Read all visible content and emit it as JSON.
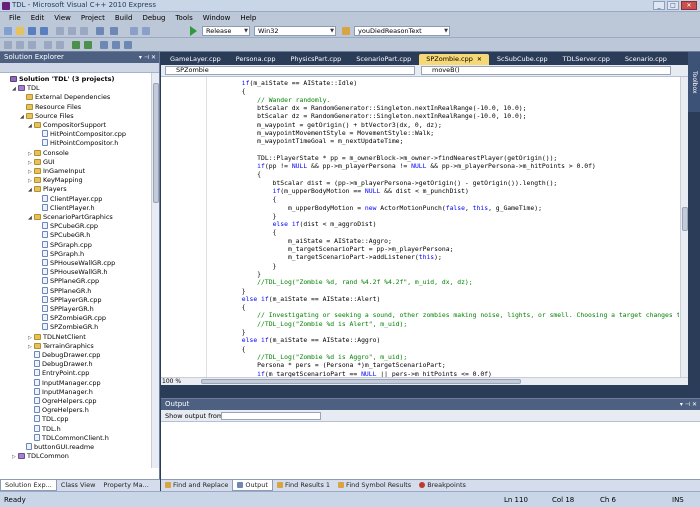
{
  "window": {
    "title": "TDL - Microsoft Visual C++ 2010 Express"
  },
  "menu": [
    "File",
    "Edit",
    "View",
    "Project",
    "Build",
    "Debug",
    "Tools",
    "Window",
    "Help"
  ],
  "toolbar": {
    "config": "Release",
    "platform": "Win32",
    "find_text": "youDiedReasonText"
  },
  "solution_explorer": {
    "title": "Solution Explorer",
    "tree": [
      {
        "label": "Solution 'TDL' (3 projects)",
        "indent": 0,
        "type": "sln",
        "expander": "",
        "bold": true
      },
      {
        "label": "TDL",
        "indent": 1,
        "type": "proj",
        "expander": "◢"
      },
      {
        "label": "External Dependencies",
        "indent": 2,
        "type": "folder",
        "expander": ""
      },
      {
        "label": "Resource Files",
        "indent": 2,
        "type": "folder",
        "expander": ""
      },
      {
        "label": "Source Files",
        "indent": 2,
        "type": "folder",
        "expander": "◢"
      },
      {
        "label": "CompositorSupport",
        "indent": 3,
        "type": "folder",
        "expander": "◢"
      },
      {
        "label": "HitPointCompositor.cpp",
        "indent": 4,
        "type": "file",
        "expander": ""
      },
      {
        "label": "HitPointCompositor.h",
        "indent": 4,
        "type": "file",
        "expander": ""
      },
      {
        "label": "Console",
        "indent": 3,
        "type": "folder",
        "expander": "▷"
      },
      {
        "label": "GUI",
        "indent": 3,
        "type": "folder",
        "expander": "▷"
      },
      {
        "label": "InGameInput",
        "indent": 3,
        "type": "folder",
        "expander": "▷"
      },
      {
        "label": "KeyMapping",
        "indent": 3,
        "type": "folder",
        "expander": "▷"
      },
      {
        "label": "Players",
        "indent": 3,
        "type": "folder",
        "expander": "◢"
      },
      {
        "label": "ClientPlayer.cpp",
        "indent": 4,
        "type": "file",
        "expander": ""
      },
      {
        "label": "ClientPlayer.h",
        "indent": 4,
        "type": "file",
        "expander": ""
      },
      {
        "label": "ScenarioPartGraphics",
        "indent": 3,
        "type": "folder",
        "expander": "◢"
      },
      {
        "label": "SPCubeGR.cpp",
        "indent": 4,
        "type": "file",
        "expander": ""
      },
      {
        "label": "SPCubeGR.h",
        "indent": 4,
        "type": "file",
        "expander": ""
      },
      {
        "label": "SPGraph.cpp",
        "indent": 4,
        "type": "file",
        "expander": ""
      },
      {
        "label": "SPGraph.h",
        "indent": 4,
        "type": "file",
        "expander": ""
      },
      {
        "label": "SPHouseWallGR.cpp",
        "indent": 4,
        "type": "file",
        "expander": ""
      },
      {
        "label": "SPHouseWallGR.h",
        "indent": 4,
        "type": "file",
        "expander": ""
      },
      {
        "label": "SPPlaneGR.cpp",
        "indent": 4,
        "type": "file",
        "expander": ""
      },
      {
        "label": "SPPlaneGR.h",
        "indent": 4,
        "type": "file",
        "expander": ""
      },
      {
        "label": "SPPlayerGR.cpp",
        "indent": 4,
        "type": "file",
        "expander": ""
      },
      {
        "label": "SPPlayerGR.h",
        "indent": 4,
        "type": "file",
        "expander": ""
      },
      {
        "label": "SPZombieGR.cpp",
        "indent": 4,
        "type": "file",
        "expander": ""
      },
      {
        "label": "SPZombieGR.h",
        "indent": 4,
        "type": "file",
        "expander": ""
      },
      {
        "label": "TDLNetClient",
        "indent": 3,
        "type": "folder",
        "expander": "▷"
      },
      {
        "label": "TerrainGraphics",
        "indent": 3,
        "type": "folder",
        "expander": "▷"
      },
      {
        "label": "DebugDrawer.cpp",
        "indent": 3,
        "type": "file",
        "expander": ""
      },
      {
        "label": "DebugDrawer.h",
        "indent": 3,
        "type": "file",
        "expander": ""
      },
      {
        "label": "EntryPoint.cpp",
        "indent": 3,
        "type": "file",
        "expander": ""
      },
      {
        "label": "InputManager.cpp",
        "indent": 3,
        "type": "file",
        "expander": ""
      },
      {
        "label": "InputManager.h",
        "indent": 3,
        "type": "file",
        "expander": ""
      },
      {
        "label": "OgreHelpers.cpp",
        "indent": 3,
        "type": "file",
        "expander": ""
      },
      {
        "label": "OgreHelpers.h",
        "indent": 3,
        "type": "file",
        "expander": ""
      },
      {
        "label": "TDL.cpp",
        "indent": 3,
        "type": "file",
        "expander": ""
      },
      {
        "label": "TDL.h",
        "indent": 3,
        "type": "file",
        "expander": ""
      },
      {
        "label": "TDLCommonClient.h",
        "indent": 3,
        "type": "file",
        "expander": ""
      },
      {
        "label": "buttonGUI.readme",
        "indent": 2,
        "type": "file",
        "expander": ""
      },
      {
        "label": "TDLCommon",
        "indent": 1,
        "type": "proj",
        "expander": "▷"
      }
    ],
    "bottom_tabs": [
      "Solution Exp...",
      "Class View",
      "Property Ma..."
    ]
  },
  "doc_tabs": [
    "GameLayer.cpp",
    "Persona.cpp",
    "PhysicsPart.cpp",
    "ScenarioPart.cpp",
    "SPZombie.cpp",
    "ScSubCube.cpp",
    "TDLServer.cpp",
    "Scenario.cpp"
  ],
  "active_tab_index": 4,
  "toolbox_label": "Toolbox",
  "nav": {
    "class": "SPZombie",
    "member": "moveB()"
  },
  "zoom": "100 %",
  "code": [
    {
      "t": "        if(m_aiState == AIState::Idle)",
      "c": 0
    },
    {
      "t": "        {",
      "c": 0
    },
    {
      "t": "            // Wander randomly.",
      "c": 1
    },
    {
      "t": "            btScalar dx = RandomGenerator::Singleton.nextInRealRange(-10.0, 10.0);",
      "c": 0
    },
    {
      "t": "            btScalar dz = RandomGenerator::Singleton.nextInRealRange(-10.0, 10.0);",
      "c": 0
    },
    {
      "t": "            m_waypoint = getOrigin() + btVector3(dx, 0, dz);",
      "c": 0
    },
    {
      "t": "            m_waypointMovementStyle = MovementStyle::Walk;",
      "c": 0
    },
    {
      "t": "            m_waypointTimeGoal = m_nextUpdateTime;",
      "c": 0
    },
    {
      "t": "",
      "c": 0
    },
    {
      "t": "            TDL::PlayerState * pp = m_ownerBlock->m_owner->findNearestPlayer(getOrigin());",
      "c": 0
    },
    {
      "t": "            if(pp != NULL && pp->m_playerPersona != NULL && pp->m_playerPersona->m_hitPoints > 0.0f)",
      "c": 0
    },
    {
      "t": "            {",
      "c": 0
    },
    {
      "t": "                btScalar dist = (pp->m_playerPersona->getOrigin() - getOrigin()).length();",
      "c": 0
    },
    {
      "t": "                if(m_upperBodyMotion == NULL && dist < m_punchDist)",
      "c": 0
    },
    {
      "t": "                {",
      "c": 0
    },
    {
      "t": "                    m_upperBodyMotion = new ActorMotionPunch(false, this, g_GameTime);",
      "c": 0
    },
    {
      "t": "                }",
      "c": 0
    },
    {
      "t": "                else if(dist < m_aggroDist)",
      "c": 0
    },
    {
      "t": "                {",
      "c": 0
    },
    {
      "t": "                    m_aiState = AIState::Aggro;",
      "c": 0
    },
    {
      "t": "                    m_targetScenarioPart = pp->m_playerPersona;",
      "c": 0
    },
    {
      "t": "                    m_targetScenarioPart->addListener(this);",
      "c": 0
    },
    {
      "t": "                }",
      "c": 0
    },
    {
      "t": "            }",
      "c": 0
    },
    {
      "t": "            //TDL_Log(\"Zombie %d, rand %4.2f %4.2f\", m_uid, dx, dz);",
      "c": 1
    },
    {
      "t": "        }",
      "c": 0
    },
    {
      "t": "        else if(m_aiState == AIState::Alert)",
      "c": 0
    },
    {
      "t": "        {",
      "c": 0
    },
    {
      "t": "            // Investigating or seeking a sound, other zombies making noise, lights, or smell. Choosing a target changes to Aggro.",
      "c": 1
    },
    {
      "t": "            //TDL_Log(\"Zombie %d is Alert\", m_uid);",
      "c": 1
    },
    {
      "t": "        }",
      "c": 0
    },
    {
      "t": "        else if(m_aiState == AIState::Aggro)",
      "c": 0
    },
    {
      "t": "        {",
      "c": 0
    },
    {
      "t": "            //TDL_Log(\"Zombie %d is Aggro\", m_uid);",
      "c": 1
    },
    {
      "t": "            Persona * pers = (Persona *)m_targetScenarioPart;",
      "c": 0
    },
    {
      "t": "            if(m_targetScenarioPart == NULL || pers->m_hitPoints <= 0.0f)",
      "c": 0
    }
  ],
  "output": {
    "title": "Output",
    "show_label": "Show output from:"
  },
  "output_tabs": [
    "Find and Replace",
    "Output",
    "Find Results 1",
    "Find Symbol Results",
    "Breakpoints"
  ],
  "status": {
    "ready": "Ready",
    "ln": "Ln 110",
    "col": "Col 18",
    "ch": "Ch 6",
    "mode": "INS"
  }
}
